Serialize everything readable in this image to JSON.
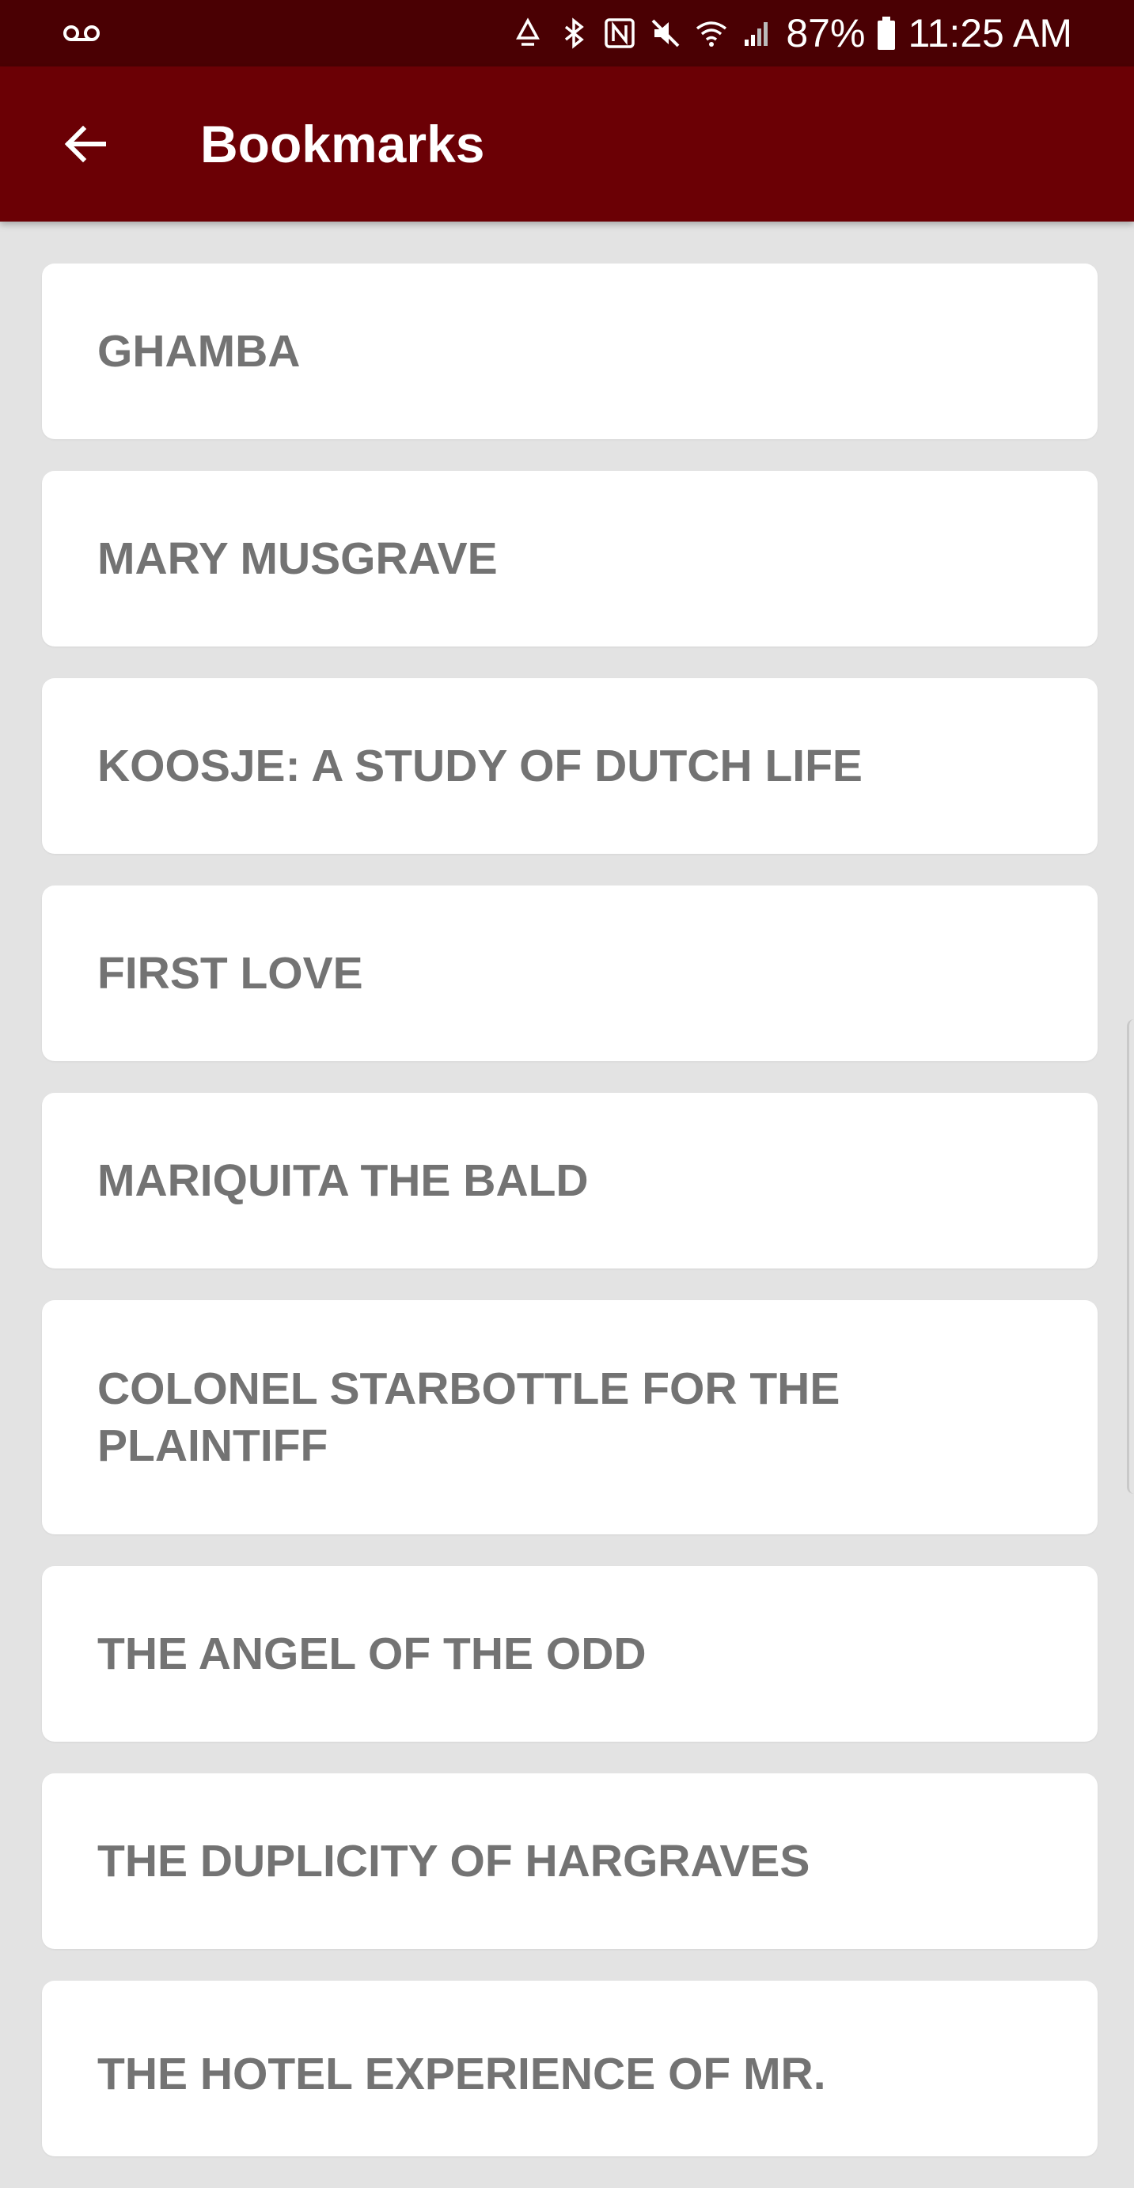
{
  "status_bar": {
    "battery_percent": "87%",
    "time": "11:25 AM",
    "icons": [
      "voicemail-icon",
      "recycle-icon",
      "bluetooth-icon",
      "nfc-icon",
      "mute-icon",
      "wifi-icon",
      "signal-icon",
      "battery-icon"
    ]
  },
  "app_bar": {
    "title": "Bookmarks",
    "back_icon": "arrow-back-icon"
  },
  "bookmarks": [
    {
      "title": "GHAMBA"
    },
    {
      "title": "MARY MUSGRAVE"
    },
    {
      "title": "KOOSJE: A STUDY OF DUTCH LIFE"
    },
    {
      "title": "FIRST LOVE"
    },
    {
      "title": "MARIQUITA THE BALD"
    },
    {
      "title": "COLONEL STARBOTTLE FOR THE PLAINTIFF"
    },
    {
      "title": "THE ANGEL OF THE ODD"
    },
    {
      "title": "THE DUPLICITY OF HARGRAVES"
    },
    {
      "title": "THE HOTEL EXPERIENCE OF MR."
    }
  ],
  "colors": {
    "status_bar": "#4a0003",
    "app_bar": "#6b0005",
    "background": "#e3e3e3",
    "card": "#ffffff",
    "card_text": "#737373"
  }
}
